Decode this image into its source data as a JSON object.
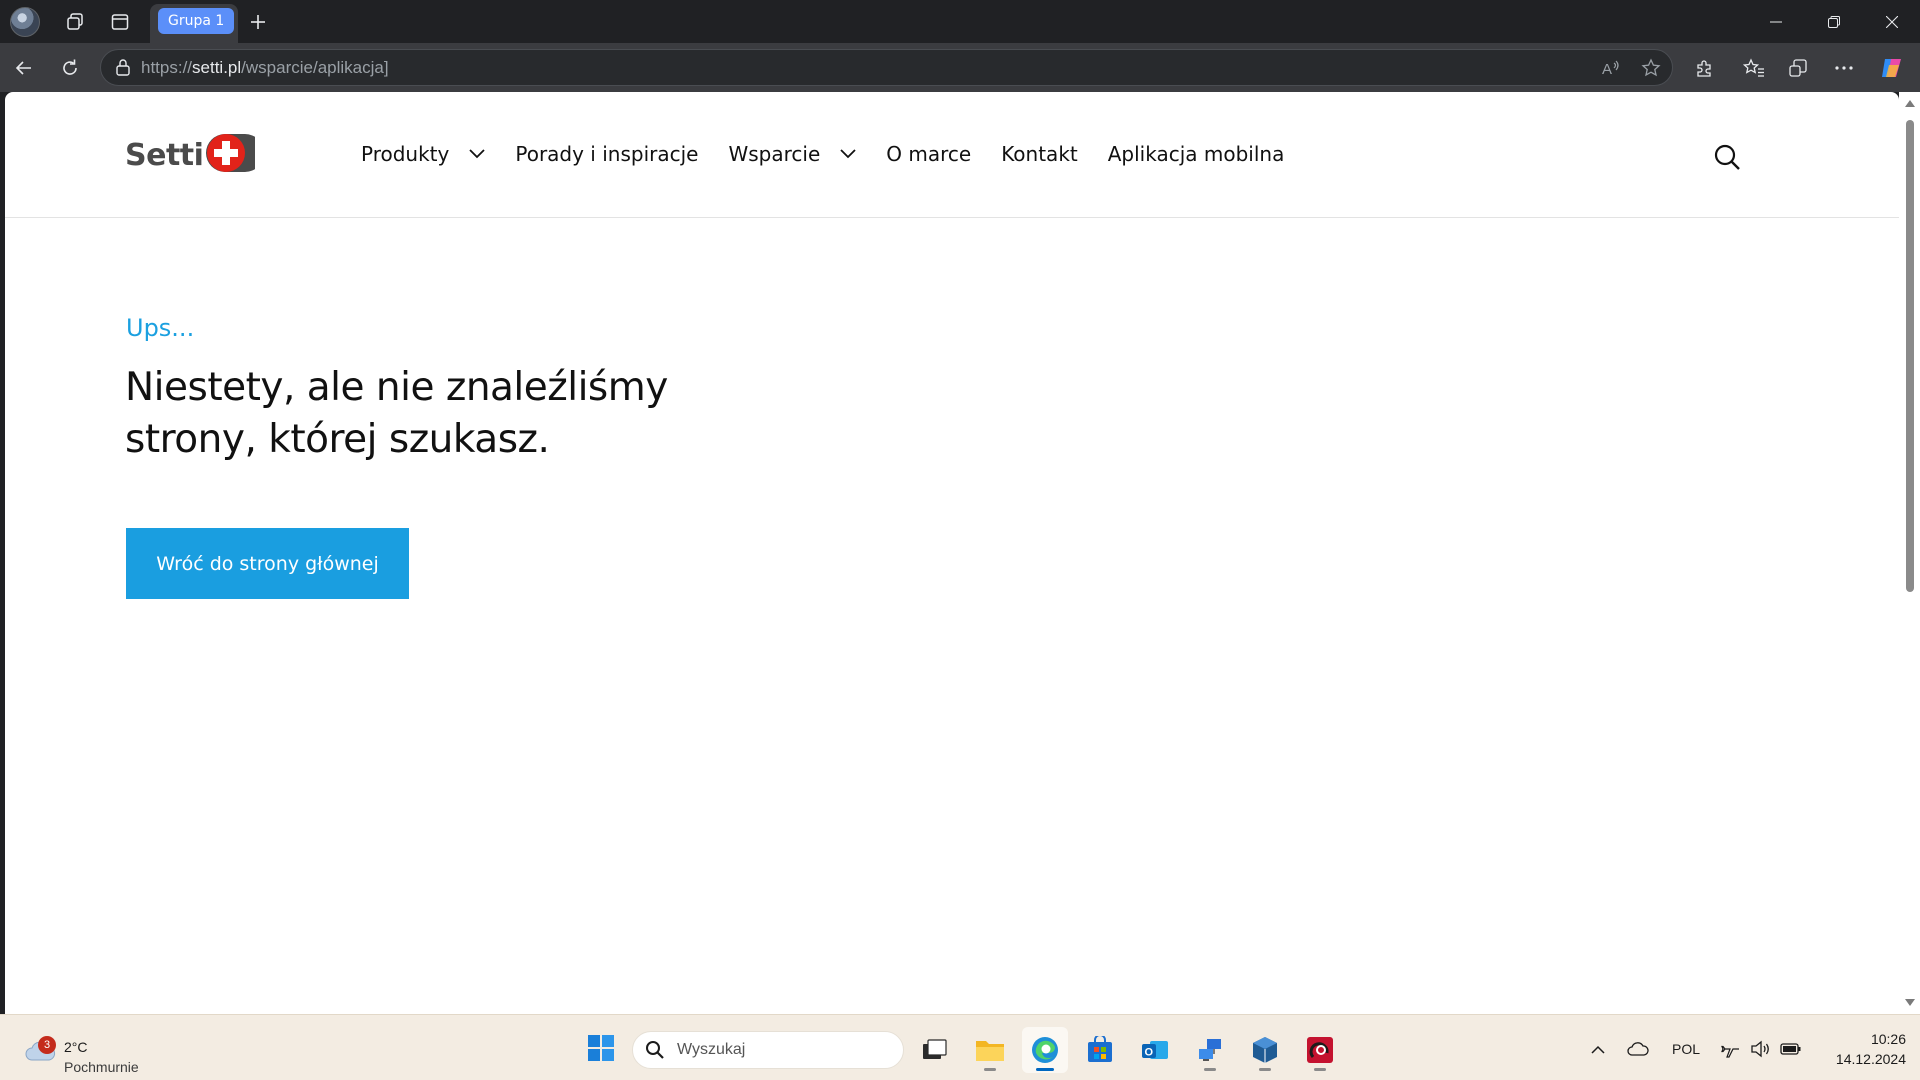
{
  "browser": {
    "tab_group_label": "Grupa 1",
    "url_prefix": "https://",
    "url_host": "setti.pl",
    "url_path": "/wsparcie/aplikacja]"
  },
  "site": {
    "logo_text": "Setti",
    "nav": [
      {
        "label": "Produkty",
        "has_dropdown": true
      },
      {
        "label": "Porady i inspiracje",
        "has_dropdown": false
      },
      {
        "label": "Wsparcie",
        "has_dropdown": true
      },
      {
        "label": "O marce",
        "has_dropdown": false
      },
      {
        "label": "Kontakt",
        "has_dropdown": false
      },
      {
        "label": "Aplikacja mobilna",
        "has_dropdown": false
      }
    ],
    "error_kicker": "Ups...",
    "error_headline_line1": "Niestety, ale nie znaleźliśmy",
    "error_headline_line2": "strony, której szukasz.",
    "home_button_label": "Wróć do strony głównej",
    "colors": {
      "accent": "#1a9ee0",
      "logo_red": "#e2231a"
    }
  },
  "taskbar": {
    "weather_temp": "2°C",
    "weather_condition": "Pochmurnie",
    "weather_badge": "3",
    "search_placeholder": "Wyszukaj",
    "language": "POL",
    "time": "10:26",
    "date": "14.12.2024",
    "apps": [
      "task-view",
      "file-explorer",
      "edge",
      "microsoft-store",
      "outlook",
      "network-tool",
      "virtualbox",
      "app-red"
    ]
  }
}
